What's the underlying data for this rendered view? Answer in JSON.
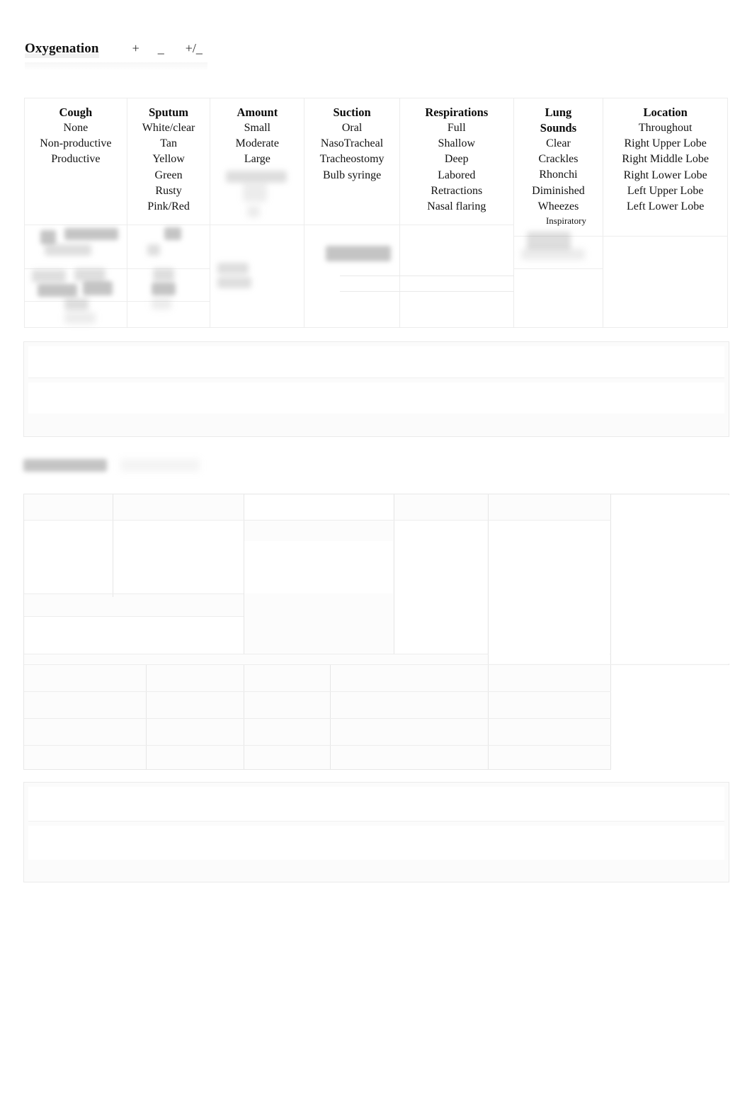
{
  "document": {
    "section_title": "Oxygenation",
    "title_markers": [
      "+",
      "_",
      "+/_"
    ]
  },
  "assessment_table": {
    "columns": [
      {
        "header": "Cough",
        "header_lines": [
          "Cough"
        ],
        "options": [
          "None",
          "Non-productive",
          "Productive"
        ]
      },
      {
        "header": "Sputum",
        "header_lines": [
          "Sputum"
        ],
        "options": [
          "White/clear",
          "Tan",
          "Yellow",
          "Green",
          "Rusty",
          "Pink/Red"
        ]
      },
      {
        "header": "Amount",
        "header_lines": [
          "Amount"
        ],
        "options": [
          "Small",
          "Moderate",
          "Large"
        ]
      },
      {
        "header": "Suction",
        "header_lines": [
          "Suction"
        ],
        "options": [
          "Oral",
          "NasoTracheal",
          "Tracheostomy",
          "Bulb syringe"
        ]
      },
      {
        "header": "Respirations",
        "header_lines": [
          "Respirations"
        ],
        "options": [
          "Full",
          "Shallow",
          "Deep",
          "Labored",
          "Retractions",
          "Nasal flaring"
        ]
      },
      {
        "header": "Lung Sounds",
        "header_lines": [
          "Lung",
          "Sounds"
        ],
        "options": [
          "Clear",
          "Crackles",
          "Rhonchi",
          "Diminished",
          "Wheezes"
        ],
        "sub_options": [
          "Inspiratory"
        ]
      },
      {
        "header": "Location",
        "header_lines": [
          "Location"
        ],
        "options": [
          "Throughout",
          "Right Upper Lobe",
          "Right Middle Lobe",
          "Right Lower Lobe",
          "Left Upper Lobe",
          "Left Lower Lobe"
        ]
      }
    ]
  },
  "notes_box_upper": {
    "rows": [
      "",
      ""
    ]
  },
  "notes_box_lower": {
    "rows": [
      "",
      ""
    ]
  },
  "lower_grid": {
    "rows": [
      [
        "",
        "",
        "",
        "",
        "",
        ""
      ],
      [
        "",
        "",
        "",
        "",
        "",
        ""
      ],
      [
        "",
        "",
        "",
        "",
        "",
        ""
      ],
      [
        "",
        "",
        "",
        "",
        "",
        ""
      ],
      [
        "",
        "",
        "",
        "",
        "",
        ""
      ],
      [
        "",
        "",
        "",
        "",
        "",
        ""
      ],
      [
        "",
        "",
        "",
        "",
        "",
        ""
      ]
    ]
  },
  "colors": {
    "page_background": "#ffffff",
    "text": "#111111",
    "border": "#ececec",
    "grid_line": "#e6e6e6"
  }
}
